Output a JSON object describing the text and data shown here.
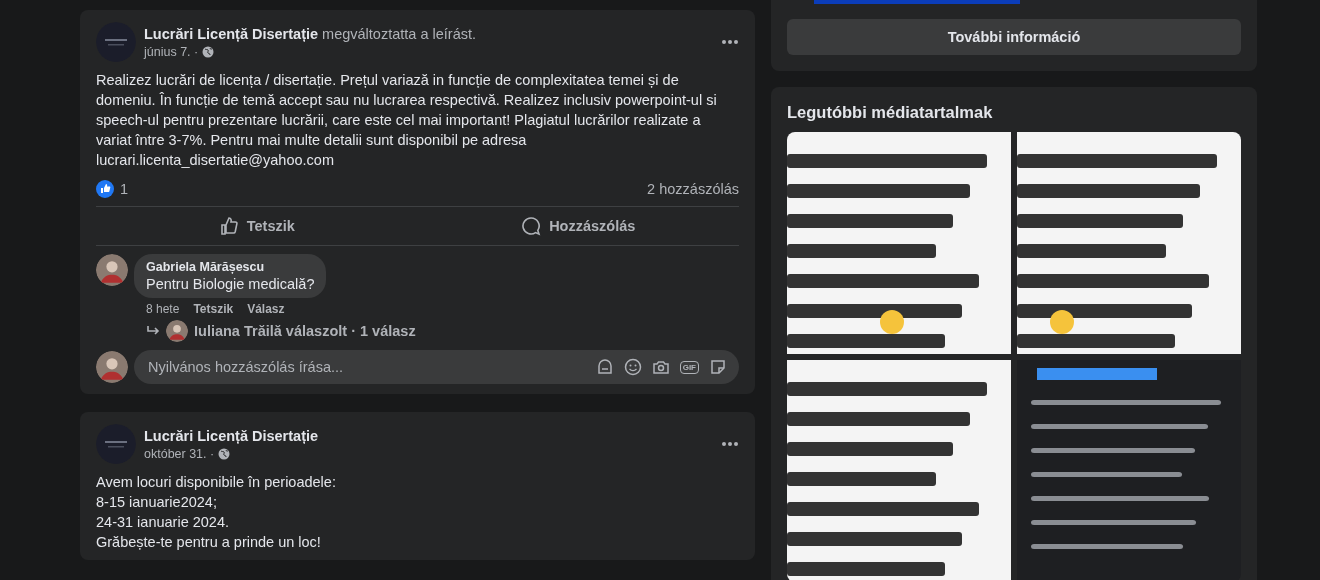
{
  "about_panel": {
    "button": "További információ"
  },
  "posts": [
    {
      "author": "Lucrări Licență Disertație",
      "action": "megváltoztatta a leírást.",
      "date": "június 7. ·",
      "text": "Realizez lucrări de licența / disertație. Prețul variază in funcție de complexitatea temei și de domeniu. În funcție de temă accept sau nu lucrarea respectivă. Realizez inclusiv powerpoint-ul si speech-ul pentru prezentare lucrării, care este cel mai important! Plagiatul lucrărilor realizate a variat între 3-7%. Pentru mai multe detalii sunt disponibil pe adresa lucrari.licenta_disertatie@yahoo.com",
      "like_count": "1",
      "comment_count": "2 hozzászólás",
      "actions": [
        {
          "kind": "like",
          "label": "Tetszik"
        },
        {
          "kind": "comment",
          "label": "Hozzászólás"
        }
      ],
      "comments": [
        {
          "author": "Gabriela Mărășescu",
          "text": "Pentru Biologie medicală?",
          "time": "8 hete",
          "actions": [
            "Tetszik",
            "Válasz"
          ],
          "reply_summary": "Iuliana Trăilă válaszolt · 1 válasz"
        }
      ],
      "comment_box": {
        "placeholder": "Nyilvános hozzászólás írása...",
        "gif_label": "GIF"
      }
    },
    {
      "author": "Lucrări Licență Disertație",
      "date": "október 31. ·",
      "text": "Avem locuri disponibile în perioadele:\n8-15 ianuarie2024;\n24-31 ianuarie 2024.\nGrăbește-te pentru a prinde un loc!"
    }
  ],
  "media": {
    "title": "Legutóbbi médiatartalmak"
  }
}
